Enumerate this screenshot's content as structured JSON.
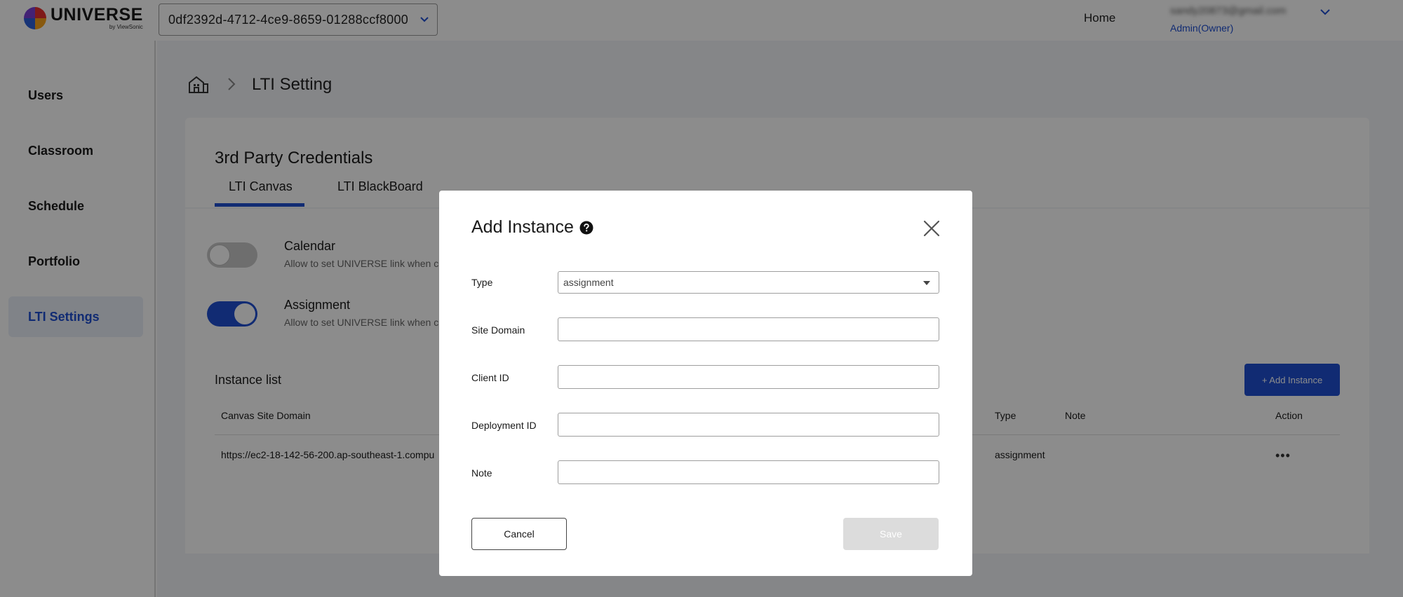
{
  "header": {
    "brand": "UNIVERSE",
    "brand_sub": "by ViewSonic",
    "org_id": "0df2392d-4712-4ce9-8659-01288ccf8000",
    "home_label": "Home",
    "user_email": "sandy20873@gmail.com",
    "user_role": "Admin(Owner)"
  },
  "sidebar": {
    "items": [
      {
        "label": "Users"
      },
      {
        "label": "Classroom"
      },
      {
        "label": "Schedule"
      },
      {
        "label": "Portfolio"
      },
      {
        "label": "LTI Settings"
      }
    ],
    "active": "LTI Settings"
  },
  "breadcrumb": {
    "title": "LTI Setting"
  },
  "credentials": {
    "title": "3rd Party Credentials",
    "tabs": [
      {
        "label": "LTI Canvas"
      },
      {
        "label": "LTI BlackBoard"
      }
    ],
    "active_tab": "LTI Canvas",
    "options": [
      {
        "title": "Calendar",
        "desc": "Allow to set UNIVERSE link when cr",
        "enabled": false
      },
      {
        "title": "Assignment",
        "desc": "Allow to set UNIVERSE link when cr",
        "enabled": true
      }
    ]
  },
  "instances": {
    "title": "Instance list",
    "add_label": "+ Add Instance",
    "columns": [
      "Canvas Site Domain",
      "Type",
      "Note",
      "Action"
    ],
    "rows": [
      {
        "domain": "https://ec2-18-142-56-200.ap-southeast-1.compu",
        "type": "assignment",
        "note": "",
        "action": "•••"
      }
    ]
  },
  "modal": {
    "title": "Add Instance",
    "fields": {
      "type": {
        "label": "Type",
        "value": "assignment"
      },
      "site_domain": {
        "label": "Site Domain",
        "value": ""
      },
      "client_id": {
        "label": "Client ID",
        "value": ""
      },
      "deployment_id": {
        "label": "Deployment ID",
        "value": ""
      },
      "note": {
        "label": "Note",
        "value": ""
      }
    },
    "cancel_label": "Cancel",
    "save_label": "Save"
  },
  "colors": {
    "accent": "#1f4fd1",
    "overlay": "rgba(0,0,0,0.45)",
    "disabled_button": "#dcdcdc"
  },
  "icons": [
    "chevron-down-icon",
    "building-icon",
    "chevron-right-icon",
    "help-icon",
    "close-icon",
    "caret-down-icon",
    "more-icon"
  ]
}
